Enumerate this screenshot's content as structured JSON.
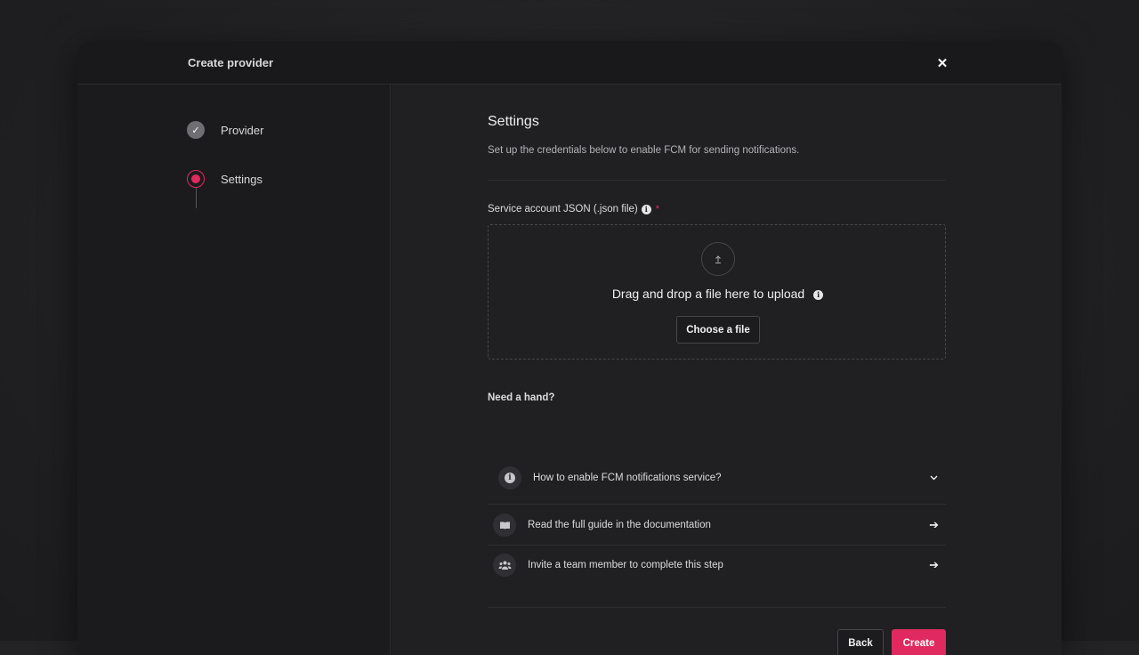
{
  "modal": {
    "title": "Create provider",
    "close_icon": "close-icon"
  },
  "steps": [
    {
      "label": "Provider",
      "state": "completed",
      "icon": "check-icon"
    },
    {
      "label": "Settings",
      "state": "current",
      "icon": "current-step-dot"
    }
  ],
  "settings": {
    "title": "Settings",
    "description": "Set up the credentials below to enable FCM for sending notifications.",
    "field": {
      "label": "Service account JSON (.json file)",
      "info_icon": "info-icon",
      "required_mark": "*"
    },
    "dropzone": {
      "upload_icon": "upload-icon",
      "text": "Drag and drop a file here to upload",
      "button_label": "Choose a file"
    }
  },
  "help": {
    "title": "Need a hand?",
    "items": [
      {
        "icon": "info-icon",
        "label": "How to enable FCM notifications service?",
        "trailing_icon": "chevron-down-icon"
      },
      {
        "icon": "book-icon",
        "label": "Read the full guide in the documentation",
        "trailing_icon": "arrow-right-icon"
      },
      {
        "icon": "team-icon",
        "label": "Invite a team member to complete this step",
        "trailing_icon": "arrow-right-icon"
      }
    ]
  },
  "footer": {
    "back_label": "Back",
    "create_label": "Create"
  },
  "colors": {
    "accent": "#e0295e",
    "background": "#202022",
    "sidebar": "#1b1b1d"
  }
}
